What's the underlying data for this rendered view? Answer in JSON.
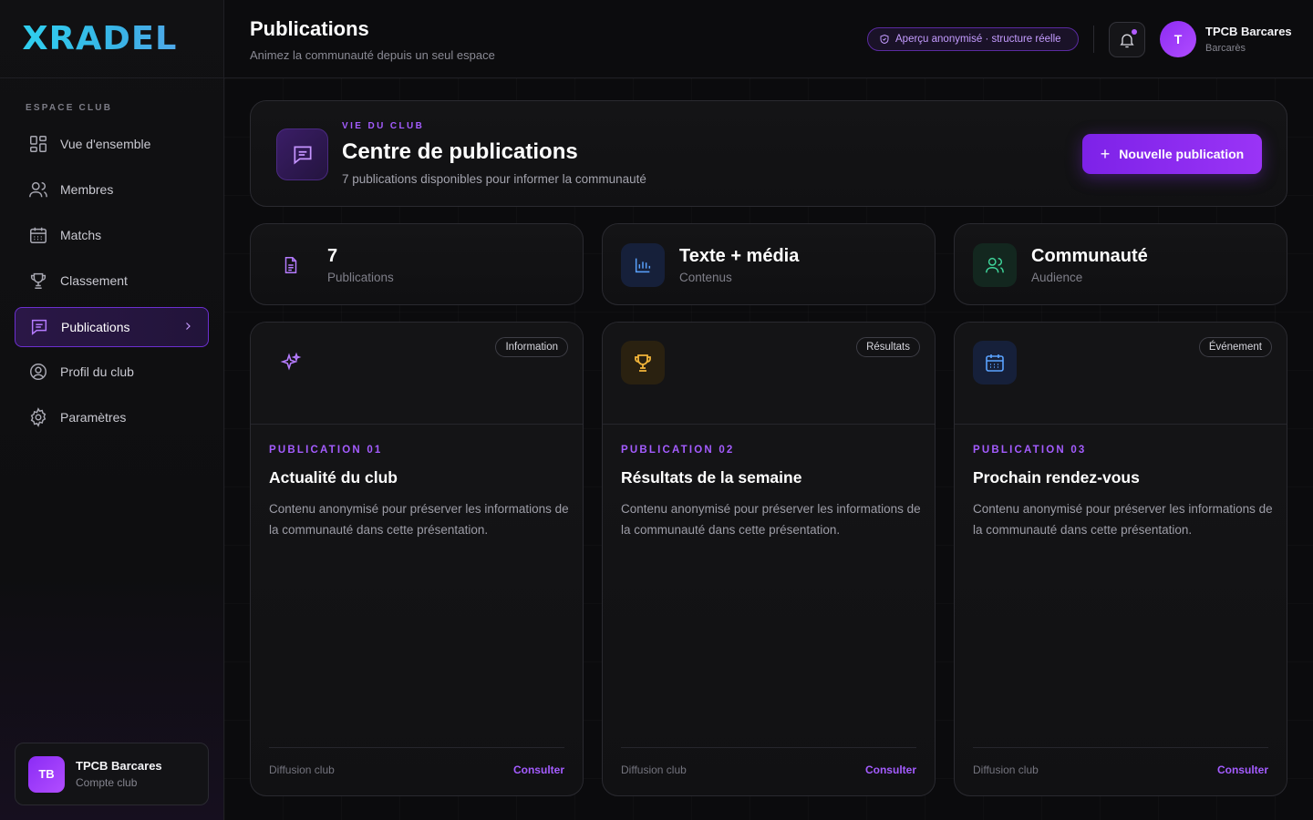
{
  "brand": {
    "logo": "XRADEL"
  },
  "sidebar": {
    "section": "ESPACE CLUB",
    "items": [
      {
        "label": "Vue d'ensemble",
        "icon": "grid-icon"
      },
      {
        "label": "Membres",
        "icon": "users-icon"
      },
      {
        "label": "Matchs",
        "icon": "calendar-icon"
      },
      {
        "label": "Classement",
        "icon": "trophy-icon"
      },
      {
        "label": "Publications",
        "icon": "message-icon",
        "active": true
      },
      {
        "label": "Profil du club",
        "icon": "user-circle-icon"
      },
      {
        "label": "Paramètres",
        "icon": "gear-icon"
      }
    ],
    "club": {
      "initials": "TB",
      "name": "TPCB Barcares",
      "sub": "Compte club"
    }
  },
  "header": {
    "title": "Publications",
    "subtitle": "Animez la communauté depuis un seul espace",
    "badge": "Aperçu anonymisé · structure réelle",
    "user": {
      "initial": "T",
      "name": "TPCB Barcares",
      "location": "Barcarès"
    }
  },
  "hero": {
    "kicker": "VIE DU CLUB",
    "title": "Centre de publications",
    "subtitle": "7 publications disponibles pour informer la communauté",
    "button": "Nouvelle publication"
  },
  "stats": [
    {
      "value": "7",
      "label": "Publications",
      "icon": "document-icon",
      "color": "#b57bff"
    },
    {
      "value": "Texte + média",
      "label": "Contenus",
      "icon": "bar-chart-icon",
      "color": "#5aa2ff"
    },
    {
      "value": "Communauté",
      "label": "Audience",
      "icon": "users-icon",
      "color": "#3fd49a"
    }
  ],
  "cards": [
    {
      "tag": "Information",
      "kicker": "PUBLICATION 01",
      "title": "Actualité du club",
      "body": "Contenu anonymisé pour préserver les informations de la communauté dans cette présentation.",
      "footer": "Diffusion club",
      "link": "Consulter",
      "icon": "sparkles-icon"
    },
    {
      "tag": "Résultats",
      "kicker": "PUBLICATION 02",
      "title": "Résultats de la semaine",
      "body": "Contenu anonymisé pour préserver les informations de la communauté dans cette présentation.",
      "footer": "Diffusion club",
      "link": "Consulter",
      "icon": "trophy-icon"
    },
    {
      "tag": "Événement",
      "kicker": "PUBLICATION 03",
      "title": "Prochain rendez-vous",
      "body": "Contenu anonymisé pour préserver les informations de la communauté dans cette présentation.",
      "footer": "Diffusion club",
      "link": "Consulter",
      "icon": "calendar-icon"
    }
  ],
  "colors": {
    "accent": "#9a34f6",
    "brand": "#2fd0ef",
    "background": "#0b0b0d"
  }
}
